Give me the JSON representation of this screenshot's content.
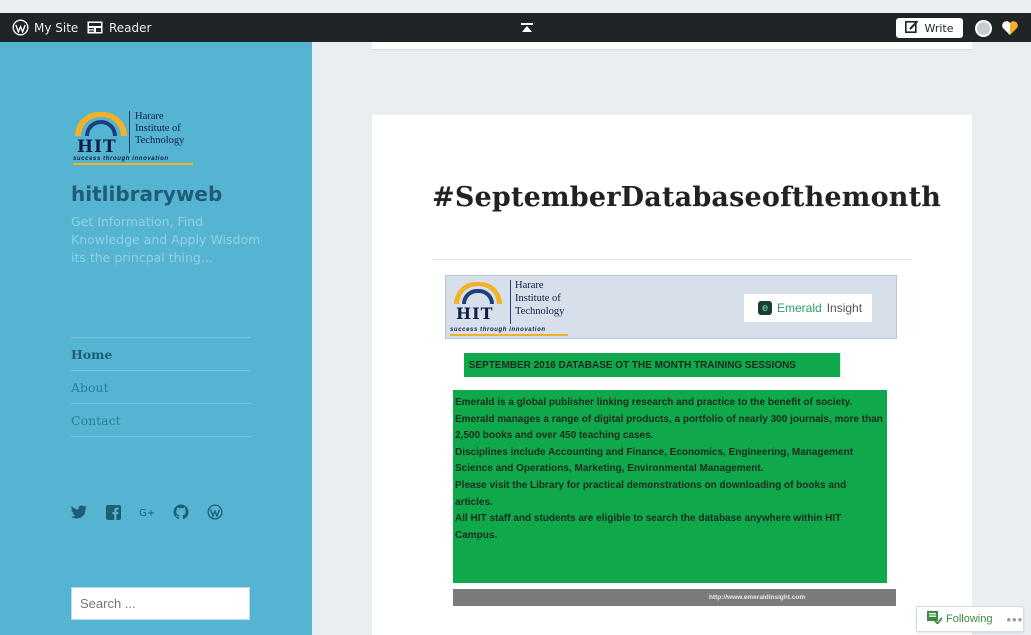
{
  "masterbar": {
    "my_site_label": "My Site",
    "reader_label": "Reader",
    "write_label": "Write",
    "icons": [
      "wordpress-icon",
      "reader-icon",
      "collapse-up-icon",
      "write-icon",
      "avatar",
      "notification-icon"
    ]
  },
  "sidebar": {
    "logo": {
      "abbr": "HIT",
      "name_line1": "Harare",
      "name_line2": "Institute of",
      "name_line3": "Technology",
      "tagline": "success through innovation"
    },
    "site_title": "hitlibraryweb",
    "site_description": "Get Information, Find Knowledge and Apply Wisdom its the princpal thing...",
    "nav": [
      {
        "label": "Home"
      },
      {
        "label": "About"
      },
      {
        "label": "Contact"
      }
    ],
    "social_icons": [
      "twitter-icon",
      "facebook-icon",
      "google-plus-icon",
      "github-icon",
      "wordpress-icon"
    ],
    "search_placeholder": "Search ..."
  },
  "post": {
    "title": "#SeptemberDatabaseofthemonth",
    "flyer": {
      "header_logo": {
        "abbr": "HIT",
        "name_line1": "Harare",
        "name_line2": "Institute of",
        "name_line3": "Technology",
        "tagline": "success through innovation"
      },
      "partner_word1": "Emerald",
      "partner_word2": "Insight",
      "headline": "SEPTEMBER 2016 DATABASE OT THE MONTH TRAINING SESSIONS",
      "paragraphs": [
        "Emerald is a global publisher linking research and practice to the benefit of society. Emerald manages a range of digital products, a portfolio of nearly 300 journals, more than 2,500 books and over 450 teaching cases.",
        "Disciplines include Accounting and Finance, Economics, Engineering, Management Science and Operations, Marketing, Environmental Management.",
        "Please visit the Library for practical demonstrations on downloading of books and articles.",
        "All HIT staff and students are eligible to search the database anywhere within HIT Campus."
      ],
      "url": "http://www.emeraldinsight.com"
    }
  },
  "follow_button": {
    "label": "Following",
    "more": "•••"
  },
  "colors": {
    "sidebar_bg": "#56b4d3",
    "masterbar_bg": "#1f2426",
    "flyer_green": "#0fa94b",
    "logo_gold": "#f2b224",
    "logo_navy": "#1d3f7a"
  }
}
